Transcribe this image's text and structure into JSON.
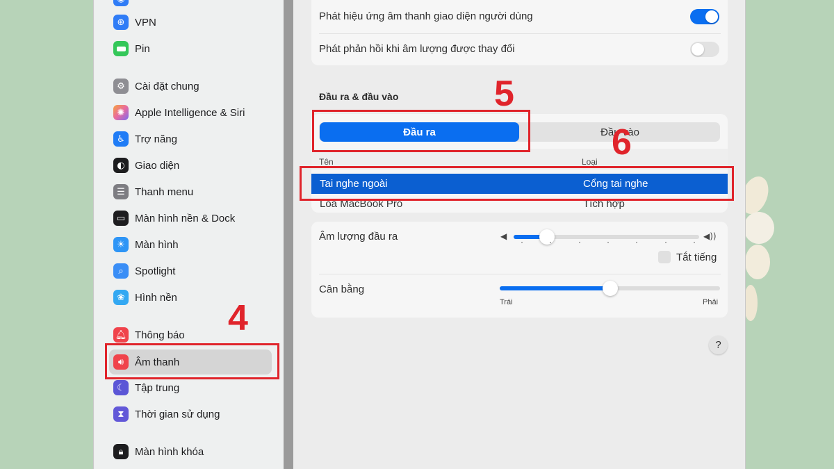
{
  "sidebar": {
    "items": [
      {
        "label": "VPN",
        "icon": "globe-icon",
        "color": "#2f7cf6"
      },
      {
        "label": "Pin",
        "icon": "battery-icon",
        "color": "#34c759"
      },
      {
        "label": "Cài đặt chung",
        "icon": "gear-icon",
        "color": "#8e8e93"
      },
      {
        "label": "Apple Intelligence & Siri",
        "icon": "siri-icon",
        "color": "#e86aa0"
      },
      {
        "label": "Trợ năng",
        "icon": "accessibility-icon",
        "color": "#1f7cf6"
      },
      {
        "label": "Giao diện",
        "icon": "appearance-icon",
        "color": "#1d1d1f"
      },
      {
        "label": "Thanh menu",
        "icon": "menubar-icon",
        "color": "#7d7d82"
      },
      {
        "label": "Màn hình nền & Dock",
        "icon": "dock-icon",
        "color": "#1d1d1f"
      },
      {
        "label": "Màn hình",
        "icon": "display-icon",
        "color": "#2e95f6"
      },
      {
        "label": "Spotlight",
        "icon": "search-icon",
        "color": "#3a8ef6"
      },
      {
        "label": "Hình nền",
        "icon": "wallpaper-icon",
        "color": "#33a8f2"
      },
      {
        "label": "Thông báo",
        "icon": "bell-icon",
        "color": "#f0434b"
      },
      {
        "label": "Âm thanh",
        "icon": "speaker-icon",
        "color": "#f0434b"
      },
      {
        "label": "Tập trung",
        "icon": "moon-icon",
        "color": "#5b56d6"
      },
      {
        "label": "Thời gian sử dụng",
        "icon": "hourglass-icon",
        "color": "#6258d8"
      },
      {
        "label": "Màn hình khóa",
        "icon": "lock-icon",
        "color": "#1d1d1f"
      }
    ]
  },
  "main": {
    "toggles": [
      {
        "label": "Phát hiệu ứng âm thanh giao diện người dùng",
        "on": true
      },
      {
        "label": "Phát phản hồi khi âm lượng được thay đổi",
        "on": false
      }
    ],
    "section_title": "Đầu ra & đầu vào",
    "tabs": [
      {
        "label": "Đầu ra",
        "active": true
      },
      {
        "label": "Đầu vào",
        "active": false
      }
    ],
    "table": {
      "columns": [
        "Tên",
        "Loại"
      ],
      "rows": [
        {
          "name": "Tai nghe ngoài",
          "type": "Cổng tai nghe",
          "selected": true
        },
        {
          "name": "Loa MacBook Pro",
          "type": "Tích hợp",
          "selected": false
        }
      ]
    },
    "volume": {
      "label": "Âm lượng đầu ra",
      "level": 0.18,
      "mute_label": "Tắt tiếng"
    },
    "balance": {
      "label": "Cân bằng",
      "level": 0.5,
      "left_label": "Trái",
      "right_label": "Phải"
    },
    "help_label": "?"
  },
  "annotations": [
    "4",
    "5",
    "6"
  ],
  "colors": {
    "accent": "#0a6ef0",
    "selected_row": "#0b5fd1",
    "annotation": "#e0242b"
  }
}
